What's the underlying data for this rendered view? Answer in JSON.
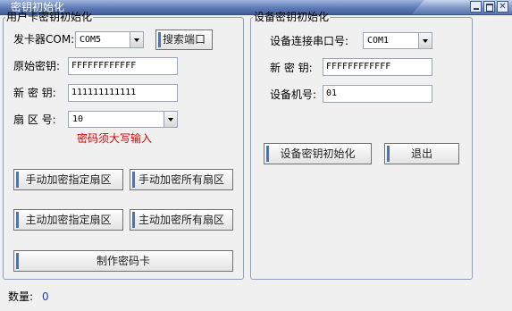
{
  "window": {
    "title": "密钥初始化",
    "min_icon": "minimize-icon",
    "max_icon": "maximize-icon",
    "close_icon": "close-icon",
    "close_glyph": "✕"
  },
  "user_group": {
    "legend": "用户卡密钥初始化",
    "card_com_label": "发卡器COM:",
    "card_com_value": "COM5",
    "search_port_button": "搜索端口",
    "orig_key_label": "原始密钥:",
    "orig_key_value": "FFFFFFFFFFFF",
    "new_key_label": "新 密 钥:",
    "new_key_value": "111111111111",
    "sector_label": "扇 区 号:",
    "sector_value": "10",
    "warning": "密码须大写输入",
    "btn_manual_specified": "手动加密指定扇区",
    "btn_manual_all": "手动加密所有扇区",
    "btn_auto_specified": "主动加密指定扇区",
    "btn_auto_all": "主动加密所有扇区",
    "btn_make_key_card": "制作密码卡"
  },
  "device_group": {
    "legend": "设备密钥初始化",
    "port_label": "设备连接串口号:",
    "port_value": "COM1",
    "new_key_label": "新 密 钥:",
    "new_key_value": "FFFFFFFFFFFF",
    "device_no_label": "设备机号:",
    "device_no_value": "01",
    "btn_init": "设备密钥初始化",
    "btn_exit": "退出"
  },
  "status": {
    "count_label": "数量:",
    "count_value": "0"
  }
}
